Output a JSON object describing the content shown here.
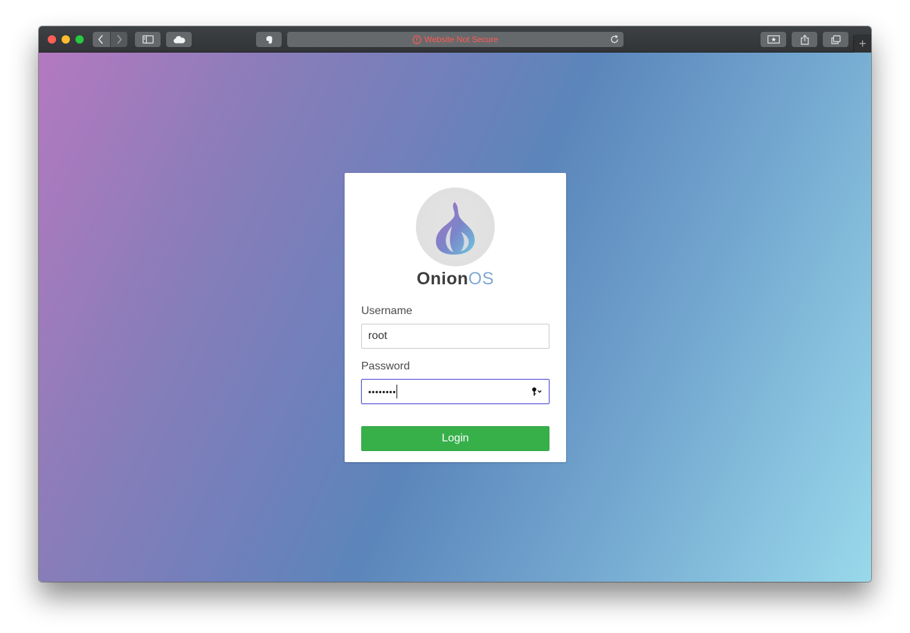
{
  "browser": {
    "address_bar": {
      "security_text": "Website Not Secure"
    },
    "buttons": {
      "back": "back-icon",
      "forward": "forward-icon",
      "sidebar": "sidebar-icon",
      "icloud": "cloud-icon",
      "extension": "evernote-icon",
      "reload": "reload-icon",
      "reader": "reader-icon",
      "share": "share-icon",
      "tabs": "tabs-overview-icon",
      "new_tab": "+"
    },
    "colors": {
      "toolbar": "#3a3c3f",
      "warning_text": "#ff5a52"
    }
  },
  "login": {
    "brand_part1": "Onion",
    "brand_part2": "OS",
    "username_label": "Username",
    "username_value": "root",
    "password_label": "Password",
    "password_masked": "••••••••",
    "submit_label": "Login",
    "colors": {
      "submit": "#37b04a",
      "focus_border": "#5a57d6"
    }
  }
}
